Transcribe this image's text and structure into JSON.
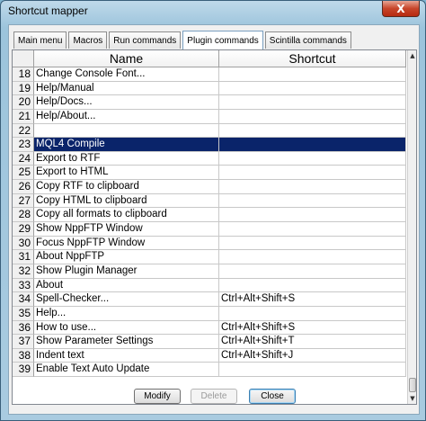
{
  "window": {
    "title": "Shortcut mapper",
    "close_glyph": "X"
  },
  "tabs": [
    {
      "label": "Main menu",
      "active": false
    },
    {
      "label": "Macros",
      "active": false
    },
    {
      "label": "Run commands",
      "active": false
    },
    {
      "label": "Plugin commands",
      "active": true
    },
    {
      "label": "Scintilla commands",
      "active": false
    }
  ],
  "grid": {
    "columns": {
      "name": "Name",
      "shortcut": "Shortcut"
    },
    "selected_row": "23",
    "rows": [
      {
        "num": "18",
        "name": "Change Console Font...",
        "shortcut": ""
      },
      {
        "num": "19",
        "name": "Help/Manual",
        "shortcut": ""
      },
      {
        "num": "20",
        "name": "Help/Docs...",
        "shortcut": ""
      },
      {
        "num": "21",
        "name": "Help/About...",
        "shortcut": ""
      },
      {
        "num": "22",
        "name": "",
        "shortcut": ""
      },
      {
        "num": "23",
        "name": "MQL4 Compile",
        "shortcut": ""
      },
      {
        "num": "24",
        "name": "Export to RTF",
        "shortcut": ""
      },
      {
        "num": "25",
        "name": "Export to HTML",
        "shortcut": ""
      },
      {
        "num": "26",
        "name": "Copy RTF to clipboard",
        "shortcut": ""
      },
      {
        "num": "27",
        "name": "Copy HTML to clipboard",
        "shortcut": ""
      },
      {
        "num": "28",
        "name": "Copy all formats to clipboard",
        "shortcut": ""
      },
      {
        "num": "29",
        "name": "Show NppFTP Window",
        "shortcut": ""
      },
      {
        "num": "30",
        "name": "Focus NppFTP Window",
        "shortcut": ""
      },
      {
        "num": "31",
        "name": "About NppFTP",
        "shortcut": ""
      },
      {
        "num": "32",
        "name": "Show Plugin Manager",
        "shortcut": ""
      },
      {
        "num": "33",
        "name": "About",
        "shortcut": ""
      },
      {
        "num": "34",
        "name": "Spell-Checker...",
        "shortcut": "Ctrl+Alt+Shift+S"
      },
      {
        "num": "35",
        "name": "Help...",
        "shortcut": ""
      },
      {
        "num": "36",
        "name": "How to use...",
        "shortcut": "Ctrl+Alt+Shift+S"
      },
      {
        "num": "37",
        "name": "Show Parameter Settings",
        "shortcut": "Ctrl+Alt+Shift+T"
      },
      {
        "num": "38",
        "name": "Indent text",
        "shortcut": "Ctrl+Alt+Shift+J"
      },
      {
        "num": "39",
        "name": "Enable Text Auto Update",
        "shortcut": ""
      }
    ]
  },
  "buttons": {
    "modify": "Modify",
    "delete": "Delete",
    "close": "Close"
  }
}
